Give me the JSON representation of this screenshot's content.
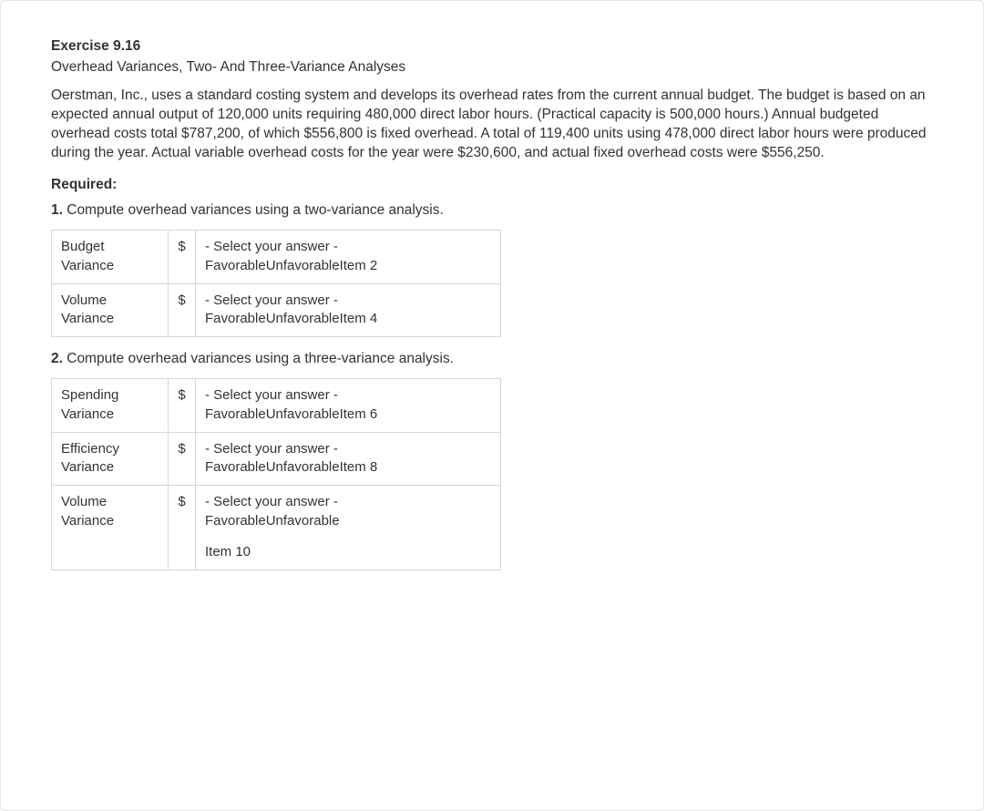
{
  "exercise_label": "Exercise 9.16",
  "title": "Overhead Variances, Two- And Three-Variance Analyses",
  "body_text": "Oerstman, Inc., uses a standard costing system and develops its overhead rates from the current annual budget. The budget is based on an expected annual output of 120,000 units requiring 480,000 direct labor hours. (Practical capacity is 500,000 hours.) Annual budgeted overhead costs total $787,200, of which $556,800 is fixed overhead. A total of 119,400 units using 478,000 direct labor hours were produced during the year. Actual variable overhead costs for the year were $230,600, and actual fixed overhead costs were $556,250.",
  "required_label": "Required:",
  "q1_num": "1.",
  "q1_text": " Compute overhead variances using a two-variance analysis.",
  "q2_num": "2.",
  "q2_text": " Compute overhead variances using a three-variance analysis.",
  "dollar": "$",
  "two_var": {
    "rows": [
      {
        "label": "Budget Variance",
        "sel1": "- Select your answer -",
        "sel2": "FavorableUnfavorableItem 2"
      },
      {
        "label": "Volume Variance",
        "sel1": "- Select your answer -",
        "sel2": "FavorableUnfavorableItem 4"
      }
    ]
  },
  "three_var": {
    "rows": [
      {
        "label": "Spending Variance",
        "sel1": "- Select your answer -",
        "sel2": "FavorableUnfavorableItem 6"
      },
      {
        "label": "Efficiency Variance",
        "sel1": "- Select your answer -",
        "sel2": "FavorableUnfavorableItem 8"
      },
      {
        "label": "Volume Variance",
        "sel1": "- Select your answer -",
        "sel2": "FavorableUnfavorable",
        "item": "Item 10"
      }
    ]
  }
}
